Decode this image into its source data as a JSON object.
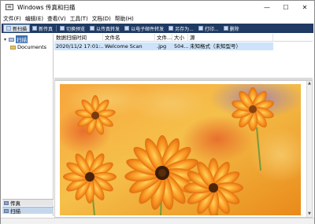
{
  "window": {
    "title": "Windows 传真和扫描",
    "controls": [
      "—",
      "☐",
      "✕"
    ]
  },
  "menu": {
    "items": [
      "文件(F)",
      "编辑(E)",
      "查看(V)",
      "工具(T)",
      "文档(D)",
      "帮助(H)"
    ]
  },
  "toolbar": {
    "new_scan": "新扫描",
    "new_fax": "新传真",
    "toggle_preview": "切换预览",
    "forward_fax": "以传真转发",
    "forward_email": "以电子邮件转发",
    "save_as": "另存为...",
    "print": "打印...",
    "delete": "删除"
  },
  "tree": {
    "root_label": "扫描",
    "child_label": "Documents"
  },
  "left_tabs": {
    "fax": "传真",
    "scan": "扫描"
  },
  "list": {
    "columns": [
      "数据扫描时间",
      "文件名",
      "文件...",
      "大小",
      "源"
    ],
    "rows": [
      {
        "date": "2020/11/2 17:01:...",
        "name": "Welcome Scan",
        "type": ".jpg",
        "size": "504...",
        "source": "未知格式（未知型号）"
      }
    ]
  },
  "colors": {
    "toolbar_bg": "#1f3a63",
    "selected_row": "#cde3fb",
    "flower_orange": "#f08a1c"
  }
}
